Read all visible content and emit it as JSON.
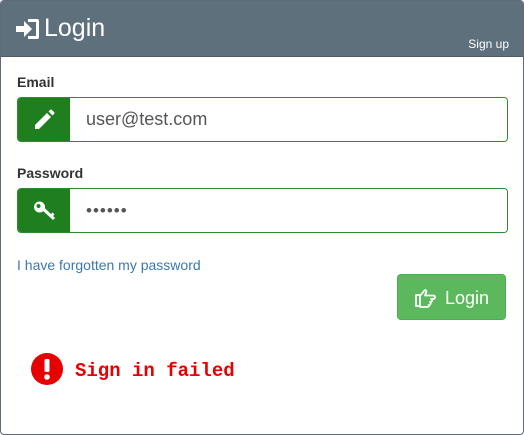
{
  "header": {
    "title": "Login",
    "title_icon": "sign-in-icon",
    "signup_label": "Sign up"
  },
  "form": {
    "email": {
      "label": "Email",
      "value": "user@test.com",
      "icon": "pencil-icon"
    },
    "password": {
      "label": "Password",
      "value": "••••••",
      "icon": "key-icon"
    },
    "forgot_label": "I have forgotten my password",
    "login_button": {
      "label": "Login",
      "icon": "hand-pointing-right-icon"
    }
  },
  "error": {
    "icon": "exclamation-circle-icon",
    "message": "Sign in failed"
  },
  "colors": {
    "header_bg": "#5f707d",
    "accent_green": "#1f7f1f",
    "button_green": "#5cb85c",
    "link_blue": "#3a78b0",
    "error_red": "#e60000"
  }
}
